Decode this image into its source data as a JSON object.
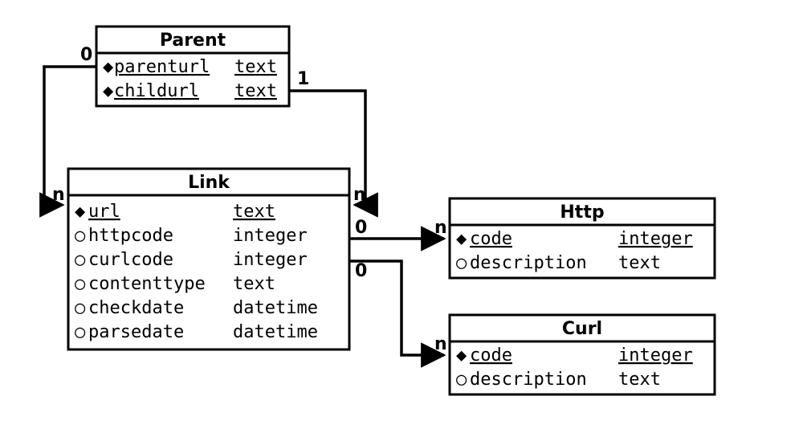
{
  "entities": {
    "parent": {
      "title": "Parent",
      "attrs": [
        {
          "name": "parenturl",
          "type": "text",
          "pk": true,
          "null": false
        },
        {
          "name": "childurl",
          "type": "text",
          "pk": true,
          "null": false
        }
      ]
    },
    "link": {
      "title": "Link",
      "attrs": [
        {
          "name": "url",
          "type": "text",
          "pk": true,
          "null": false
        },
        {
          "name": "httpcode",
          "type": "integer",
          "pk": false,
          "null": true
        },
        {
          "name": "curlcode",
          "type": "integer",
          "pk": false,
          "null": true
        },
        {
          "name": "contenttype",
          "type": "text",
          "pk": false,
          "null": true
        },
        {
          "name": "checkdate",
          "type": "datetime",
          "pk": false,
          "null": true
        },
        {
          "name": "parsedate",
          "type": "datetime",
          "pk": false,
          "null": true
        }
      ]
    },
    "http": {
      "title": "Http",
      "attrs": [
        {
          "name": "code",
          "type": "integer",
          "pk": true,
          "null": false
        },
        {
          "name": "description",
          "type": "text",
          "pk": false,
          "null": true
        }
      ]
    },
    "curl": {
      "title": "Curl",
      "attrs": [
        {
          "name": "code",
          "type": "integer",
          "pk": true,
          "null": false
        },
        {
          "name": "description",
          "type": "text",
          "pk": false,
          "null": true
        }
      ]
    }
  },
  "relations": [
    {
      "from": "parent.parenturl",
      "to": "link.url",
      "from_card": "0",
      "to_card": "n"
    },
    {
      "from": "parent.childurl",
      "to": "link.url",
      "from_card": "1",
      "to_card": "n"
    },
    {
      "from": "link.httpcode",
      "to": "http.code",
      "from_card": "0",
      "to_card": "n"
    },
    {
      "from": "link.curlcode",
      "to": "curl.code",
      "from_card": "0",
      "to_card": "n"
    }
  ],
  "cardinality_labels": {
    "zero": "0",
    "one": "1",
    "many": "n"
  }
}
